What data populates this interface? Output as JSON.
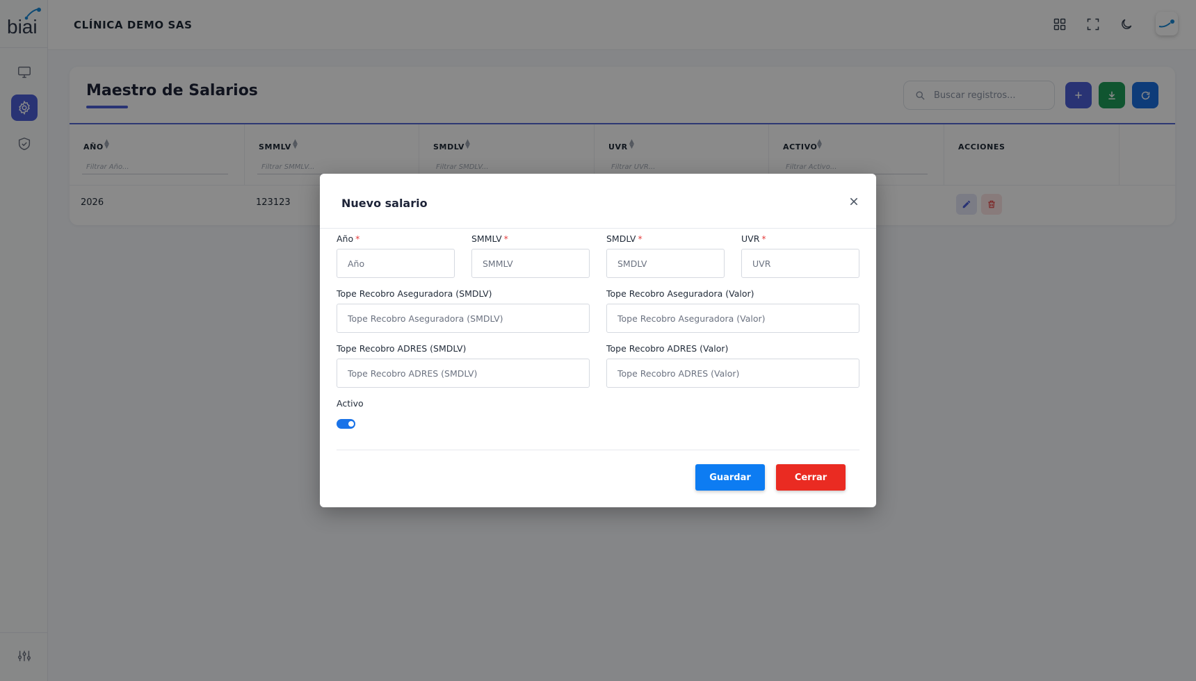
{
  "app": {
    "logo_text": "biai",
    "company": "CLÍNICA DEMO SAS"
  },
  "sidebar": {
    "items": [
      {
        "icon": "monitor-icon",
        "active": false
      },
      {
        "icon": "gear-icon",
        "active": true
      },
      {
        "icon": "shield-check-icon",
        "active": false
      }
    ],
    "bottom_icon": "sliders-icon"
  },
  "topbar": {
    "icons": [
      "grid-icon",
      "fullscreen-icon",
      "moon-icon"
    ],
    "avatar_icon": "user-avatar"
  },
  "page": {
    "title": "Maestro de Salarios",
    "search_placeholder": "Buscar registros...",
    "actions": [
      {
        "name": "add",
        "color": "#4c5fd7"
      },
      {
        "name": "download",
        "color": "#1e9e5a"
      },
      {
        "name": "refresh",
        "color": "#1a6fe0"
      }
    ]
  },
  "table": {
    "columns": [
      {
        "label": "AÑO",
        "filter_placeholder": "Filtrar Año..."
      },
      {
        "label": "SMMLV",
        "filter_placeholder": "Filtrar SMMLV..."
      },
      {
        "label": "SMDLV",
        "filter_placeholder": "Filtrar SMDLV..."
      },
      {
        "label": "UVR",
        "filter_placeholder": "Filtrar UVR..."
      },
      {
        "label": "ACTIVO",
        "filter_placeholder": "Filtrar Activo..."
      },
      {
        "label": "ACCIONES"
      }
    ],
    "rows": [
      {
        "ano": "2026",
        "smmlv": "123123"
      }
    ]
  },
  "modal": {
    "title": "Nuevo salario",
    "fields": {
      "ano": {
        "label": "Año",
        "placeholder": "Año",
        "required": true
      },
      "smmlv": {
        "label": "SMMLV",
        "placeholder": "SMMLV",
        "required": true
      },
      "smdlv": {
        "label": "SMDLV",
        "placeholder": "SMDLV",
        "required": true
      },
      "uvr": {
        "label": "UVR",
        "placeholder": "UVR",
        "required": true
      },
      "tope_aseg_smdlv": {
        "label": "Tope Recobro Aseguradora (SMDLV)",
        "placeholder": "Tope Recobro Aseguradora (SMDLV)"
      },
      "tope_aseg_valor": {
        "label": "Tope Recobro Aseguradora (Valor)",
        "placeholder": "Tope Recobro Aseguradora (Valor)"
      },
      "tope_adres_smdlv": {
        "label": "Tope Recobro ADRES (SMDLV)",
        "placeholder": "Tope Recobro ADRES (SMDLV)"
      },
      "tope_adres_valor": {
        "label": "Tope Recobro ADRES (Valor)",
        "placeholder": "Tope Recobro ADRES (Valor)"
      }
    },
    "required_mark": "*",
    "activo_label": "Activo",
    "activo_value": true,
    "save_label": "Guardar",
    "close_label": "Cerrar"
  },
  "colors": {
    "primary": "#4c5fd7",
    "save": "#0d7cf2",
    "danger": "#ea2b22",
    "toggle": "#1a73e8"
  }
}
